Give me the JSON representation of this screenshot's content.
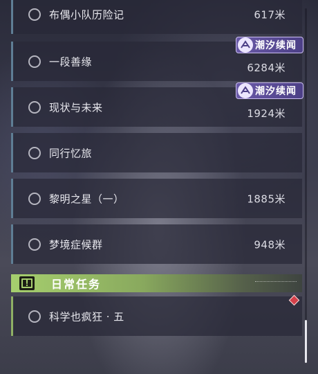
{
  "quests": [
    {
      "title": "布偶小队历险记",
      "distance": "617米",
      "tag": ""
    },
    {
      "title": "一段善缘",
      "distance": "6284米",
      "tag": "潮汐续闻"
    },
    {
      "title": "现状与未来",
      "distance": "1924米",
      "tag": "潮汐续闻"
    },
    {
      "title": "同行忆旅",
      "distance": "",
      "tag": ""
    },
    {
      "title": "黎明之星（一）",
      "distance": "1885米",
      "tag": ""
    },
    {
      "title": "梦境症候群",
      "distance": "948米",
      "tag": ""
    }
  ],
  "daily_section": {
    "title": "日常任务",
    "icon": "exclamation-box-icon",
    "quest": {
      "title": "科学也疯狂 · 五",
      "distance": ""
    }
  },
  "colors": {
    "accent_blue": "#5f7e95",
    "accent_green": "#a6cf6e",
    "badge_purple": "#6a5aa8",
    "alert_red": "#d4404a"
  }
}
